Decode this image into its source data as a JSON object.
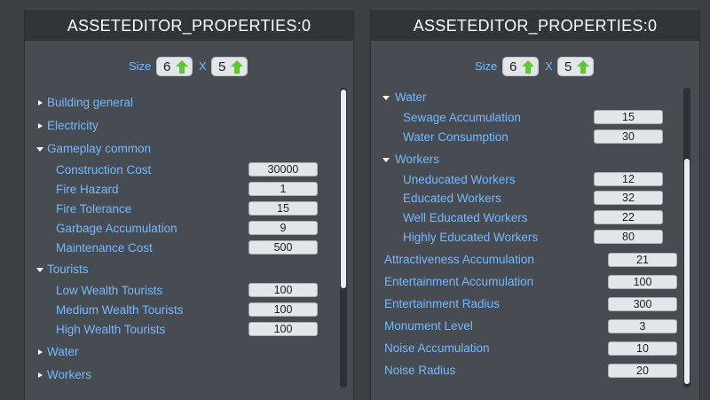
{
  "left_panel": {
    "title": "ASSETEDITOR_PROPERTIES:0",
    "size": {
      "label": "Size",
      "x_label": "X",
      "width": "6",
      "height": "5"
    },
    "tree": [
      {
        "type": "section",
        "label": "Building general",
        "expanded": false
      },
      {
        "type": "section",
        "label": "Electricity",
        "expanded": false
      },
      {
        "type": "section",
        "label": "Gameplay common",
        "expanded": true
      },
      {
        "type": "prop",
        "label": "Construction Cost",
        "value": "30000"
      },
      {
        "type": "prop",
        "label": "Fire Hazard",
        "value": "1"
      },
      {
        "type": "prop",
        "label": "Fire Tolerance",
        "value": "15"
      },
      {
        "type": "prop",
        "label": "Garbage Accumulation",
        "value": "9"
      },
      {
        "type": "prop",
        "label": "Maintenance Cost",
        "value": "500"
      },
      {
        "type": "section",
        "label": "Tourists",
        "expanded": true
      },
      {
        "type": "prop",
        "label": "Low Wealth Tourists",
        "value": "100"
      },
      {
        "type": "prop",
        "label": "Medium Wealth Tourists",
        "value": "100"
      },
      {
        "type": "prop",
        "label": "High Wealth Tourists",
        "value": "100"
      },
      {
        "type": "section",
        "label": "Water",
        "expanded": false
      },
      {
        "type": "section",
        "label": "Workers",
        "expanded": false
      }
    ]
  },
  "right_panel": {
    "title": "ASSETEDITOR_PROPERTIES:0",
    "size": {
      "label": "Size",
      "x_label": "X",
      "width": "6",
      "height": "5"
    },
    "tree": [
      {
        "type": "section",
        "label": "Water",
        "expanded": true
      },
      {
        "type": "prop",
        "label": "Sewage Accumulation",
        "value": "15"
      },
      {
        "type": "prop",
        "label": "Water Consumption",
        "value": "30"
      },
      {
        "type": "section",
        "label": "Workers",
        "expanded": true
      },
      {
        "type": "prop",
        "label": "Uneducated Workers",
        "value": "12"
      },
      {
        "type": "prop",
        "label": "Educated Workers",
        "value": "32"
      },
      {
        "type": "prop",
        "label": "Well Educated Workers",
        "value": "22"
      },
      {
        "type": "prop",
        "label": "Highly Educated Workers",
        "value": "80"
      },
      {
        "type": "top",
        "label": "Attractiveness Accumulation",
        "value": "21"
      },
      {
        "type": "top",
        "label": "Entertainment Accumulation",
        "value": "100"
      },
      {
        "type": "top",
        "label": "Entertainment Radius",
        "value": "300"
      },
      {
        "type": "top",
        "label": "Monument Level",
        "value": "3"
      },
      {
        "type": "top",
        "label": "Noise Accumulation",
        "value": "10"
      },
      {
        "type": "top",
        "label": "Noise Radius",
        "value": "20"
      }
    ]
  },
  "colors": {
    "label_blue": "#74b9ff",
    "arrow_green": "#5cc832",
    "panel_bg": "#464c52",
    "header_bg": "#303539"
  },
  "icons": {
    "collapsed": "triangle-right-icon",
    "expanded": "triangle-down-icon",
    "increment": "green-up-arrow-icon"
  }
}
